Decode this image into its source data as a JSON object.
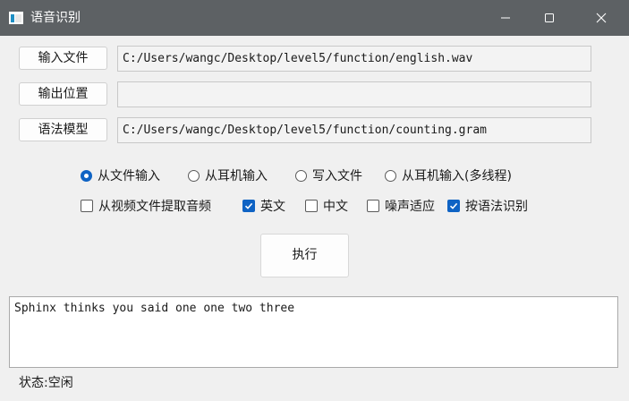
{
  "window": {
    "title": "语音识别",
    "icons": {
      "app": "app-window-icon",
      "minimize": "minimize-icon",
      "maximize": "maximize-icon",
      "close": "close-icon"
    }
  },
  "inputs": {
    "input_file": {
      "button_label": "输入文件",
      "value": "C:/Users/wangc/Desktop/level5/function/english.wav"
    },
    "output_location": {
      "button_label": "输出位置",
      "value": ""
    },
    "grammar_model": {
      "button_label": "语法模型",
      "value": "C:/Users/wangc/Desktop/level5/function/counting.gram"
    }
  },
  "mode_radios": [
    {
      "label": "从文件输入",
      "selected": true
    },
    {
      "label": "从耳机输入",
      "selected": false
    },
    {
      "label": "写入文件",
      "selected": false
    },
    {
      "label": "从耳机输入(多线程)",
      "selected": false
    }
  ],
  "option_checks": [
    {
      "label": "从视频文件提取音频",
      "checked": false
    },
    {
      "label": "英文",
      "checked": true
    },
    {
      "label": "中文",
      "checked": false
    },
    {
      "label": "噪声适应",
      "checked": false
    },
    {
      "label": "按语法识别",
      "checked": true
    }
  ],
  "execute_label": "执行",
  "output_text": "Sphinx thinks you said one one two three",
  "status_text": "状态:空闲",
  "colors": {
    "titlebar": "#5d6164",
    "accent": "#0f63c4",
    "background": "#f0f0f0"
  }
}
